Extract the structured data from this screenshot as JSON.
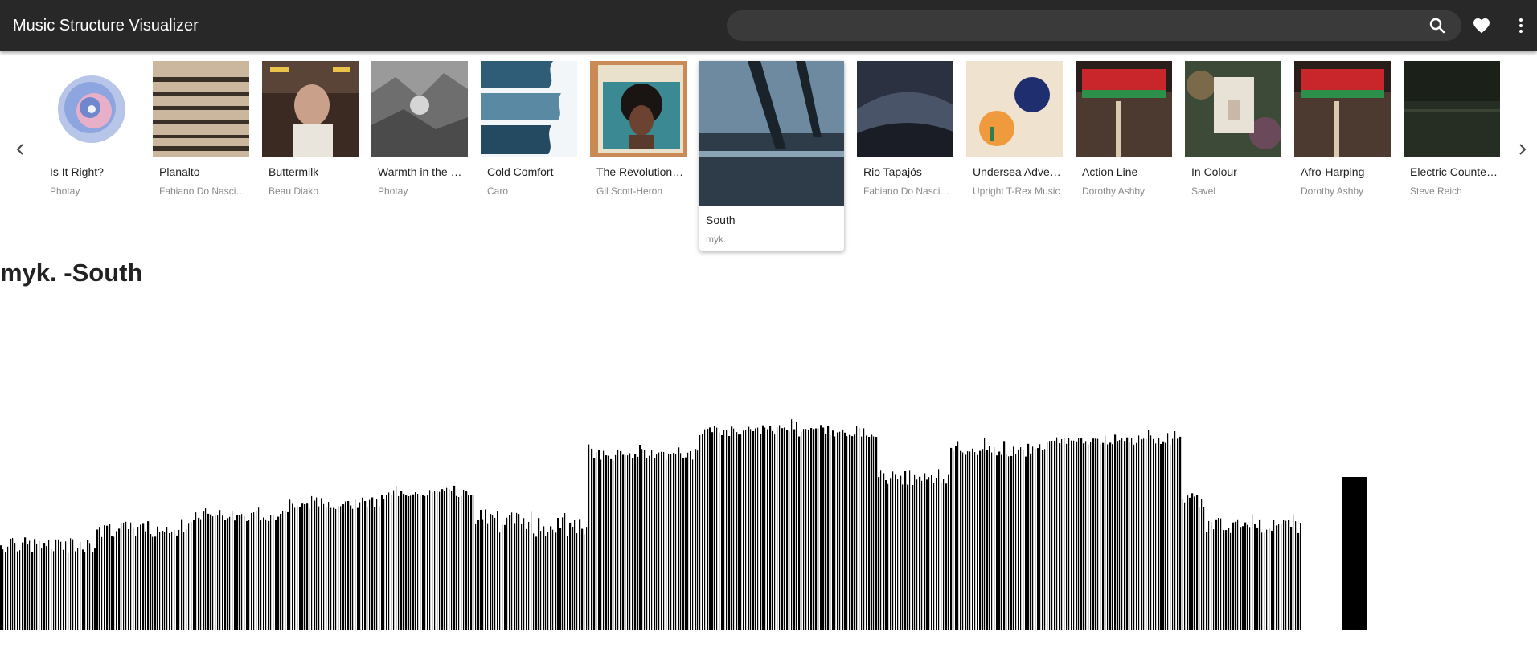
{
  "app": {
    "title": "Music Structure Visualizer"
  },
  "search": {
    "value": "",
    "placeholder": "",
    "icon": "search-icon"
  },
  "header_icons": [
    "favorites-heart-icon",
    "more-vert-icon"
  ],
  "carousel": {
    "prev_icon": "chevron-left-icon",
    "next_icon": "chevron-right-icon",
    "albums": [
      {
        "title": "Is It Right?",
        "artist": "Photay"
      },
      {
        "title": "Planalto",
        "artist": "Fabiano Do Nascimento"
      },
      {
        "title": "Buttermilk",
        "artist": "Beau Diako"
      },
      {
        "title": "Warmth in the Wilderness",
        "artist": "Photay"
      },
      {
        "title": "Cold Comfort",
        "artist": "Caro"
      },
      {
        "title": "The Revolution Will Not Be Televised",
        "artist": "Gil Scott-Heron"
      },
      {
        "title": "South",
        "artist": "myk.",
        "selected": true
      },
      {
        "title": "Rio Tapajós",
        "artist": "Fabiano Do Nascimento"
      },
      {
        "title": "Undersea Adventures",
        "artist": "Upright T-Rex Music"
      },
      {
        "title": "Action Line",
        "artist": "Dorothy Ashby"
      },
      {
        "title": "In Colour",
        "artist": "Savel"
      },
      {
        "title": "Afro-Harping",
        "artist": "Dorothy Ashby"
      },
      {
        "title": "Electric Counterpoint",
        "artist": "Steve Reich"
      }
    ]
  },
  "track": {
    "heading": "myk. -South"
  },
  "colors": {
    "appbar": "#282828",
    "bars": "#000000",
    "search_bg": "#3a3a3a"
  }
}
